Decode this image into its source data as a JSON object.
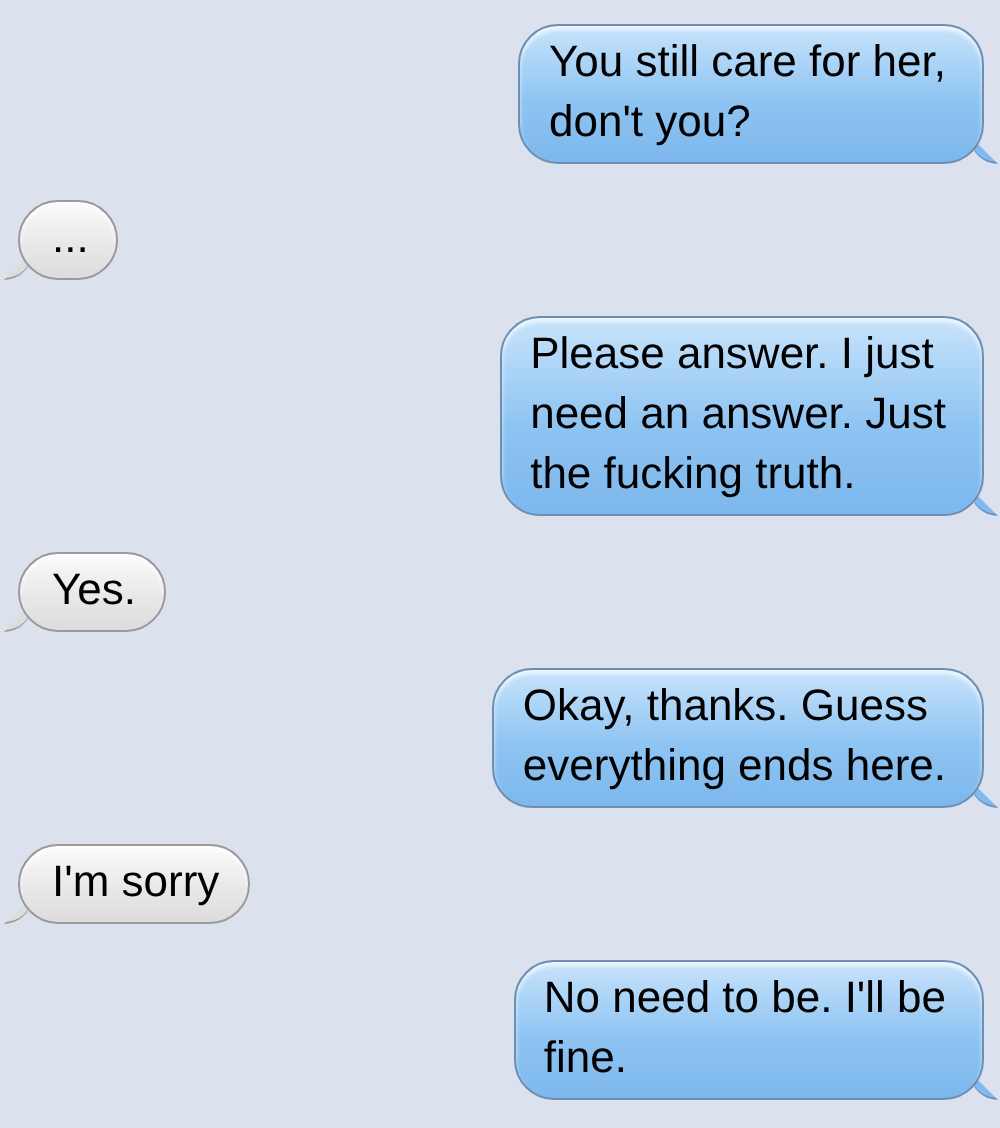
{
  "messages": [
    {
      "kind": "sent",
      "text": "You still care for her,\ndon't you?"
    },
    {
      "kind": "received",
      "text": "..."
    },
    {
      "kind": "sent",
      "text": "Please answer. I just\nneed an answer. Just\nthe fucking truth."
    },
    {
      "kind": "received",
      "text": "Yes."
    },
    {
      "kind": "sent",
      "text": "Okay, thanks. Guess\neverything ends here."
    },
    {
      "kind": "received",
      "text": "I'm sorry"
    },
    {
      "kind": "sent",
      "text": "No need to be. I'll be\nfine."
    }
  ]
}
